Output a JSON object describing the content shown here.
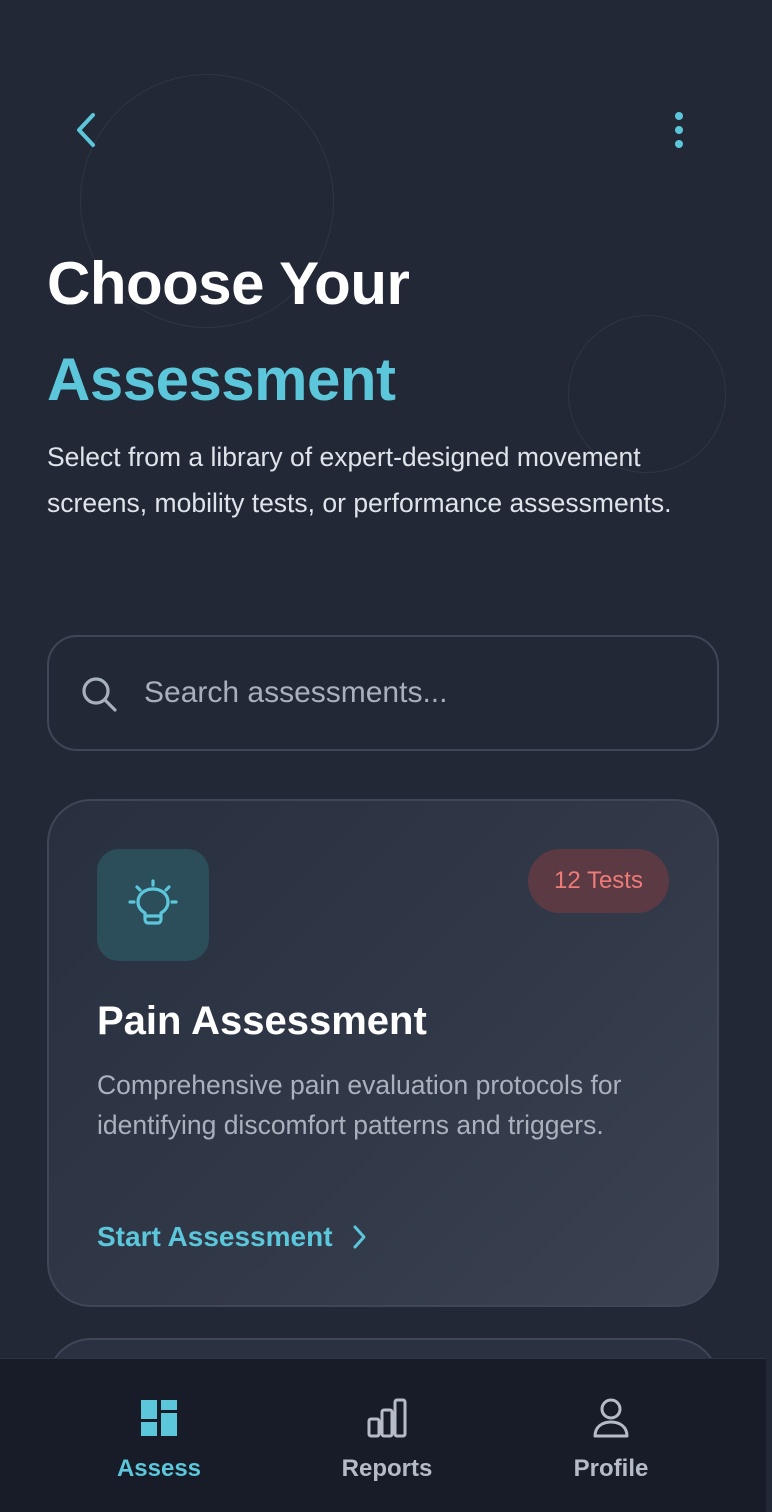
{
  "header": {
    "back_icon": "chevron-left-icon",
    "more_icon": "more-vertical-icon",
    "title_line1": "Choose Your",
    "title_line2": "Assessment",
    "subtitle": "Select from a library of expert-designed movement screens, mobility tests, or performance assessments."
  },
  "search": {
    "icon": "search-icon",
    "placeholder": "Search assessments...",
    "value": ""
  },
  "cards": [
    {
      "icon": "lightbulb-icon",
      "badge": "12 Tests",
      "title": "Pain Assessment",
      "description": "Comprehensive pain evaluation protocols for identifying discomfort patterns and triggers.",
      "action_label": "Start Assessment",
      "action_icon": "chevron-right-icon"
    }
  ],
  "bottom_nav": {
    "items": [
      {
        "label": "Assess",
        "icon": "dashboard-icon",
        "active": true
      },
      {
        "label": "Reports",
        "icon": "bar-chart-icon",
        "active": false
      },
      {
        "label": "Profile",
        "icon": "user-icon",
        "active": false
      }
    ]
  },
  "colors": {
    "background": "#222836",
    "accent": "#5cc6da",
    "badge_text": "#ee7b78",
    "badge_bg": "#5b3a44",
    "nav_bg": "#171c28"
  }
}
